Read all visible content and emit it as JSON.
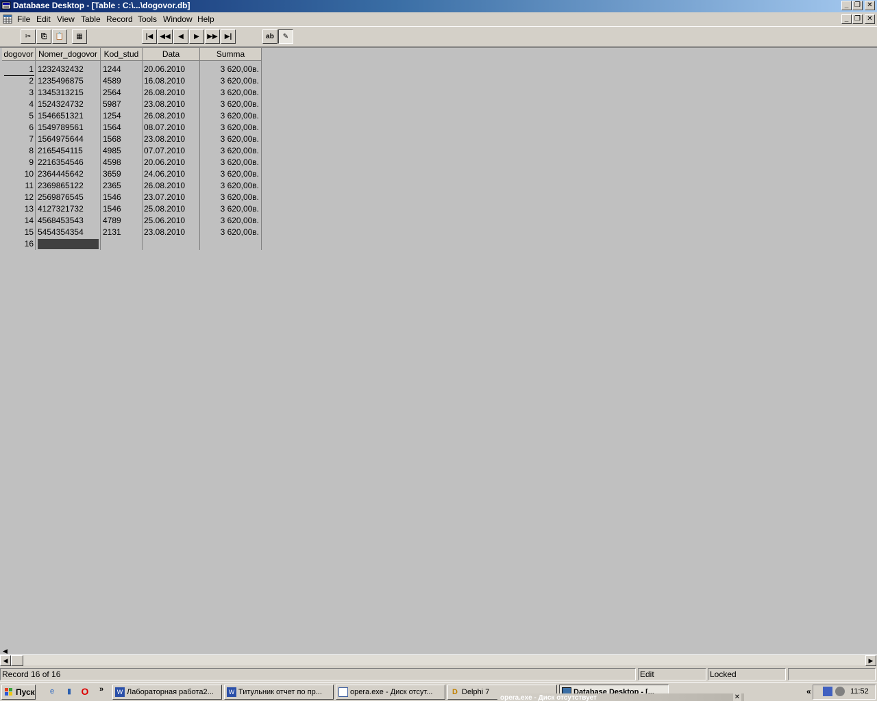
{
  "window": {
    "title": "Database Desktop - [Table : C:\\...\\dogovor.db]",
    "min_glyph": "_",
    "restore_glyph": "❐",
    "close_glyph": "✕"
  },
  "menu": [
    "File",
    "Edit",
    "View",
    "Table",
    "Record",
    "Tools",
    "Window",
    "Help"
  ],
  "toolbar": {
    "icons": [
      "cut-icon",
      "copy-icon",
      "paste-icon",
      "print-icon",
      "first-record-icon",
      "prev-set-icon",
      "prev-record-icon",
      "next-record-icon",
      "next-set-icon",
      "last-record-icon",
      "field-view-icon",
      "edit-data-icon"
    ],
    "glyphs": {
      "cut": "✂",
      "copy": "⎘",
      "paste": "📋",
      "print": "▦",
      "first": "|◀",
      "prev_set": "◀◀",
      "prev": "◀",
      "next": "▶",
      "next_set": "▶▶",
      "last": "▶|",
      "field_view": "ab",
      "edit_data": "✎"
    }
  },
  "table": {
    "columns": [
      "dogovor",
      "Nomer_dogovor",
      "Kod_stud",
      "Data",
      "Summa"
    ],
    "rows": [
      {
        "dogovor": "1",
        "nomer": "1232432432",
        "kod": "1244",
        "data": "20.06.2010",
        "summa": "3 620,00в."
      },
      {
        "dogovor": "2",
        "nomer": "1235496875",
        "kod": "4589",
        "data": "16.08.2010",
        "summa": "3 620,00в."
      },
      {
        "dogovor": "3",
        "nomer": "1345313215",
        "kod": "2564",
        "data": "26.08.2010",
        "summa": "3 620,00в."
      },
      {
        "dogovor": "4",
        "nomer": "1524324732",
        "kod": "5987",
        "data": "23.08.2010",
        "summa": "3 620,00в."
      },
      {
        "dogovor": "5",
        "nomer": "1546651321",
        "kod": "1254",
        "data": "26.08.2010",
        "summa": "3 620,00в."
      },
      {
        "dogovor": "6",
        "nomer": "1549789561",
        "kod": "1564",
        "data": "08.07.2010",
        "summa": "3 620,00в."
      },
      {
        "dogovor": "7",
        "nomer": "1564975644",
        "kod": "1568",
        "data": "23.08.2010",
        "summa": "3 620,00в."
      },
      {
        "dogovor": "8",
        "nomer": "2165454115",
        "kod": "4985",
        "data": "07.07.2010",
        "summa": "3 620,00в."
      },
      {
        "dogovor": "9",
        "nomer": "2216354546",
        "kod": "4598",
        "data": "20.06.2010",
        "summa": "3 620,00в."
      },
      {
        "dogovor": "10",
        "nomer": "2364445642",
        "kod": "3659",
        "data": "24.06.2010",
        "summa": "3 620,00в."
      },
      {
        "dogovor": "11",
        "nomer": "2369865122",
        "kod": "2365",
        "data": "26.08.2010",
        "summa": "3 620,00в."
      },
      {
        "dogovor": "12",
        "nomer": "2569876545",
        "kod": "1546",
        "data": "23.07.2010",
        "summa": "3 620,00в."
      },
      {
        "dogovor": "13",
        "nomer": "4127321732",
        "kod": "1546",
        "data": "25.08.2010",
        "summa": "3 620,00в."
      },
      {
        "dogovor": "14",
        "nomer": "4568453543",
        "kod": "4789",
        "data": "25.06.2010",
        "summa": "3 620,00в."
      },
      {
        "dogovor": "15",
        "nomer": "5454354354",
        "kod": "2131",
        "data": "23.08.2010",
        "summa": "3 620,00в."
      },
      {
        "dogovor": "16",
        "nomer": "",
        "kod": "",
        "data": "",
        "summa": ""
      }
    ],
    "selected_row": 16,
    "selected_column": "Nomer_dogovor"
  },
  "scrollbar": {
    "left_glyph": "◀",
    "right_glyph": "▶"
  },
  "status": {
    "record": "Record 16 of 16",
    "mode": "Edit",
    "lock": "Locked"
  },
  "taskbar": {
    "start": "Пуск",
    "more_glyph": "»",
    "items": [
      {
        "label": "Лабораторная работа2...",
        "active": false
      },
      {
        "label": "Титульник отчет по пр...",
        "active": false
      },
      {
        "label": "opera.exe - Диск отсут...",
        "active": false
      },
      {
        "label": "Delphi 7",
        "active": false
      },
      {
        "label": "Database Desktop - [...",
        "active": true
      }
    ],
    "tray_expand_glyph": "«",
    "clock": "11:52",
    "popup_title": "opera.exe - Диск отсутствует"
  },
  "colors": {
    "title_start": "#0a246a",
    "title_end": "#a6caf0",
    "grid_bg": "#c0c0c0",
    "selection": "#404040"
  }
}
